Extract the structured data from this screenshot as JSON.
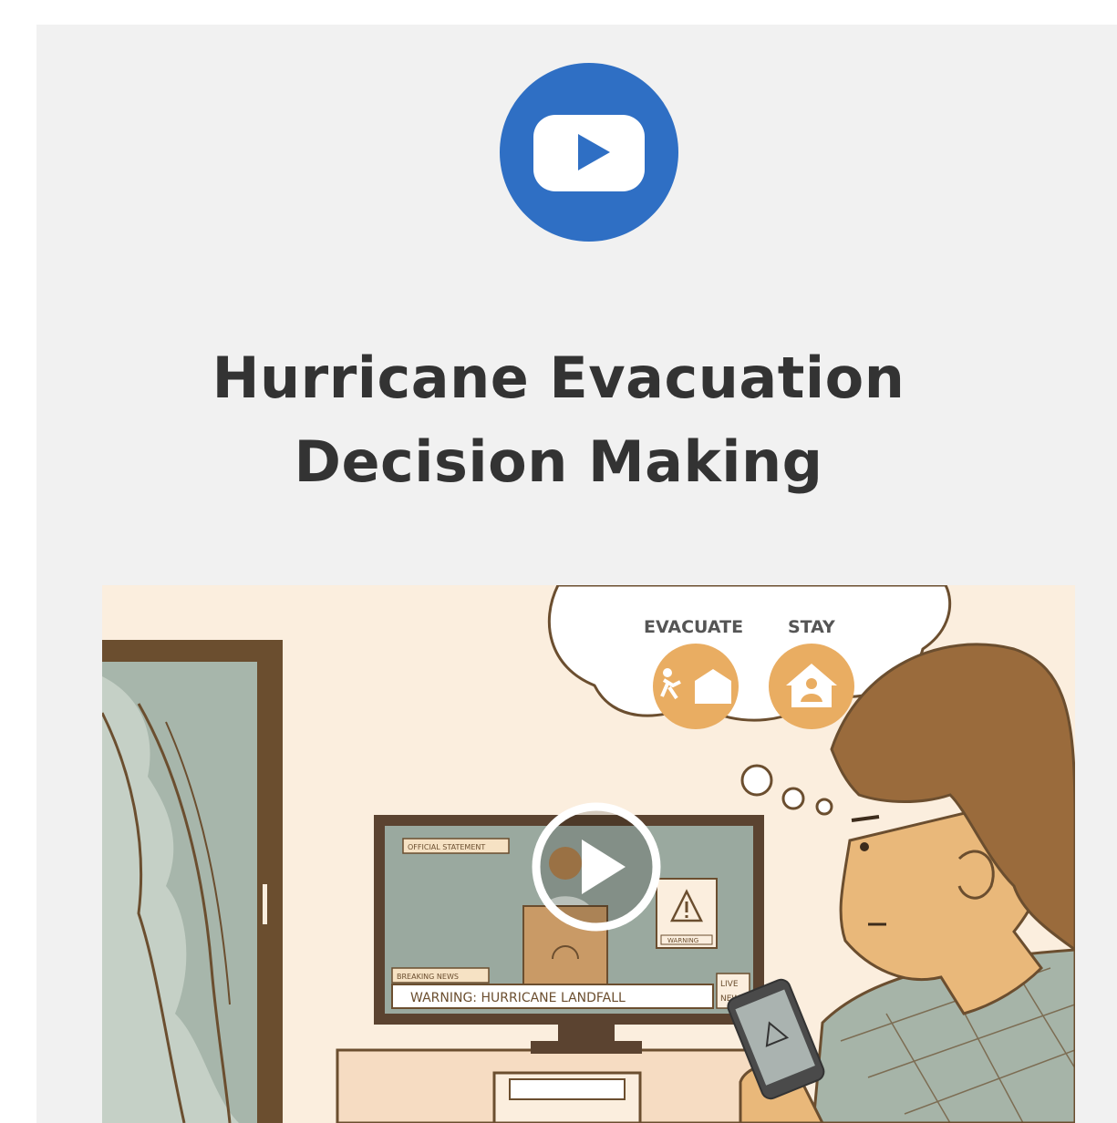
{
  "badge": {
    "icon": "youtube-play-icon"
  },
  "title": {
    "line1": "Hurricane Evacuation",
    "line2": "Decision Making"
  },
  "thumbnail": {
    "thought": {
      "evacuate_label": "EVACUATE",
      "stay_label": "STAY"
    },
    "tv": {
      "official_statement": "OFFICIAL STATEMENT",
      "warning_box": "WARNING",
      "breaking_news": "BREAKING NEWS",
      "ticker": "WARNING: HURRICANE LANDFALL",
      "live_1": "LIVE",
      "live_2": "NEWS"
    },
    "play_icon": "play-circle-icon"
  },
  "colors": {
    "badge_blue": "#2f6fc4",
    "title_text": "#333333",
    "card_bg": "#f1f1f1",
    "scene_bg": "#fbeede",
    "orange": "#e9ad62",
    "brown": "#6b4e2f",
    "sage": "#a6b4a8"
  }
}
